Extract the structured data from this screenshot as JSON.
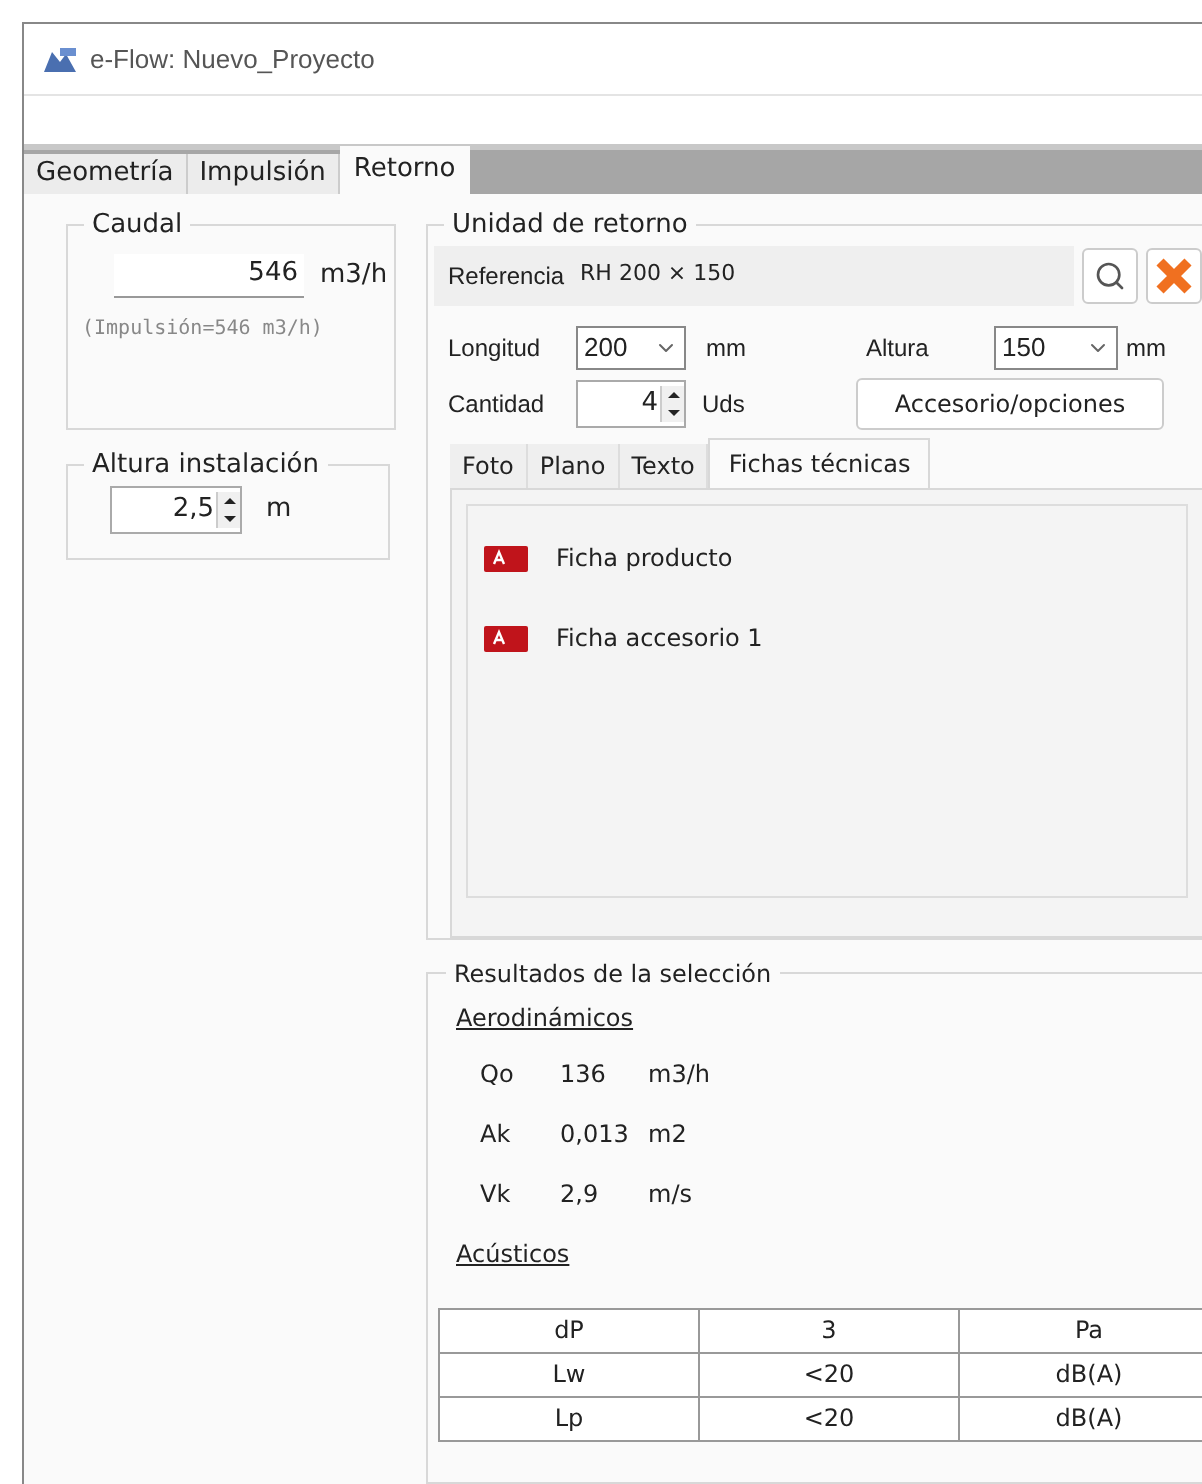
{
  "window": {
    "title": "e-Flow: Nuevo_Proyecto"
  },
  "tabs": [
    {
      "label": "Geometría",
      "selected": false
    },
    {
      "label": "Impulsión",
      "selected": false
    },
    {
      "label": "Retorno",
      "selected": true
    }
  ],
  "caudal": {
    "title": "Caudal",
    "value": "546",
    "unit": "m3/h",
    "note": "(Impulsión=546 m3/h)"
  },
  "altura_instalacion": {
    "title": "Altura instalación",
    "value": "2,5",
    "unit": "m"
  },
  "unidad": {
    "title": "Unidad de retorno",
    "referencia_label": "Referencia",
    "referencia": "RH 200 × 150",
    "longitud": {
      "label": "Longitud",
      "value": "200",
      "unit": "mm"
    },
    "altura": {
      "label": "Altura",
      "value": "150",
      "unit": "mm"
    },
    "cantidad": {
      "label": "Cantidad",
      "value": "4",
      "unit": "Uds"
    },
    "accessory_button": "Accesorio/opciones",
    "tabs": [
      {
        "label": "Foto",
        "selected": false
      },
      {
        "label": "Plano",
        "selected": false
      },
      {
        "label": "Texto",
        "selected": false
      },
      {
        "label": "Fichas técnicas",
        "selected": true
      }
    ],
    "documents": [
      {
        "label": "Ficha producto"
      },
      {
        "label": "Ficha accesorio 1"
      }
    ]
  },
  "resultados": {
    "title": "Resultados de la selección",
    "aerodinamicos": {
      "title": "Aerodinámicos",
      "rows": [
        {
          "name": "Qo",
          "value": "136",
          "unit": "m3/h"
        },
        {
          "name": "Ak",
          "value": "0,013",
          "unit": "m2"
        },
        {
          "name": "Vk",
          "value": "2,9",
          "unit": "m/s"
        }
      ]
    },
    "acusticos": {
      "title": "Acústicos",
      "rows": [
        [
          "dP",
          "3",
          "Pa"
        ],
        [
          "Lw",
          "<20",
          "dB(A)"
        ],
        [
          "Lp",
          "<20",
          "dB(A)"
        ]
      ]
    }
  }
}
